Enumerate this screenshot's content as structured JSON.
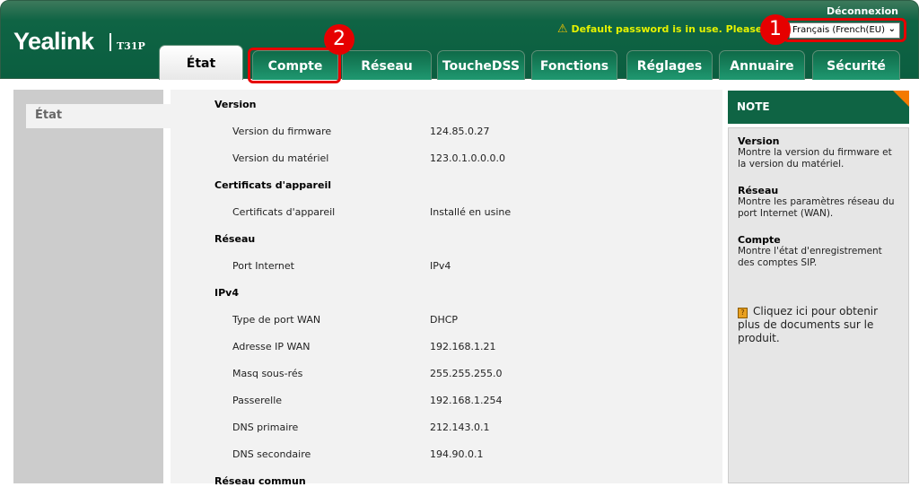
{
  "header": {
    "brand": "Yealink",
    "model": "T31P",
    "logout": "Déconnexion",
    "warning": "Default password is in use. Please cha",
    "language": "Français (French(EU)",
    "warning_color": "#e5f200"
  },
  "tabs": [
    {
      "label": "État",
      "active": true
    },
    {
      "label": "Compte"
    },
    {
      "label": "Réseau"
    },
    {
      "label": "ToucheDSS"
    },
    {
      "label": "Fonctions"
    },
    {
      "label": "Réglages"
    },
    {
      "label": "Annuaire"
    },
    {
      "label": "Sécurité"
    }
  ],
  "callouts": [
    "1",
    "2"
  ],
  "sidebar": {
    "items": [
      {
        "label": "État"
      }
    ]
  },
  "main": {
    "rows": [
      {
        "type": "section",
        "label": "Version"
      },
      {
        "type": "row",
        "label": "Version du firmware",
        "value": "124.85.0.27"
      },
      {
        "type": "row",
        "label": "Version du matériel",
        "value": "123.0.1.0.0.0.0"
      },
      {
        "type": "section",
        "label": "Certificats d'appareil"
      },
      {
        "type": "row",
        "label": "Certificats d'appareil",
        "value": "Installé en usine"
      },
      {
        "type": "section",
        "label": "Réseau"
      },
      {
        "type": "row",
        "label": "Port Internet",
        "value": "IPv4"
      },
      {
        "type": "section",
        "label": "IPv4"
      },
      {
        "type": "row",
        "label": "Type de port WAN",
        "value": "DHCP"
      },
      {
        "type": "row",
        "label": "Adresse IP WAN",
        "value": "192.168.1.21"
      },
      {
        "type": "row",
        "label": "Masq sous-rés",
        "value": "255.255.255.0"
      },
      {
        "type": "row",
        "label": "Passerelle",
        "value": "192.168.1.254"
      },
      {
        "type": "row",
        "label": "DNS primaire",
        "value": "212.143.0.1"
      },
      {
        "type": "row",
        "label": "DNS secondaire",
        "value": "194.90.0.1"
      },
      {
        "type": "section",
        "label": "Réseau commun"
      }
    ]
  },
  "note": {
    "title": "NOTE",
    "items": [
      {
        "title": "Version",
        "text": "Montre la version du firmware et la version du matériel."
      },
      {
        "title": "Réseau",
        "text": "Montre les paramètres réseau du port Internet (WAN)."
      },
      {
        "title": "Compte",
        "text": "Montre l'état d'enregistrement des comptes SIP."
      }
    ],
    "link": "Cliquez ici pour obtenir plus de documents sur le produit."
  }
}
